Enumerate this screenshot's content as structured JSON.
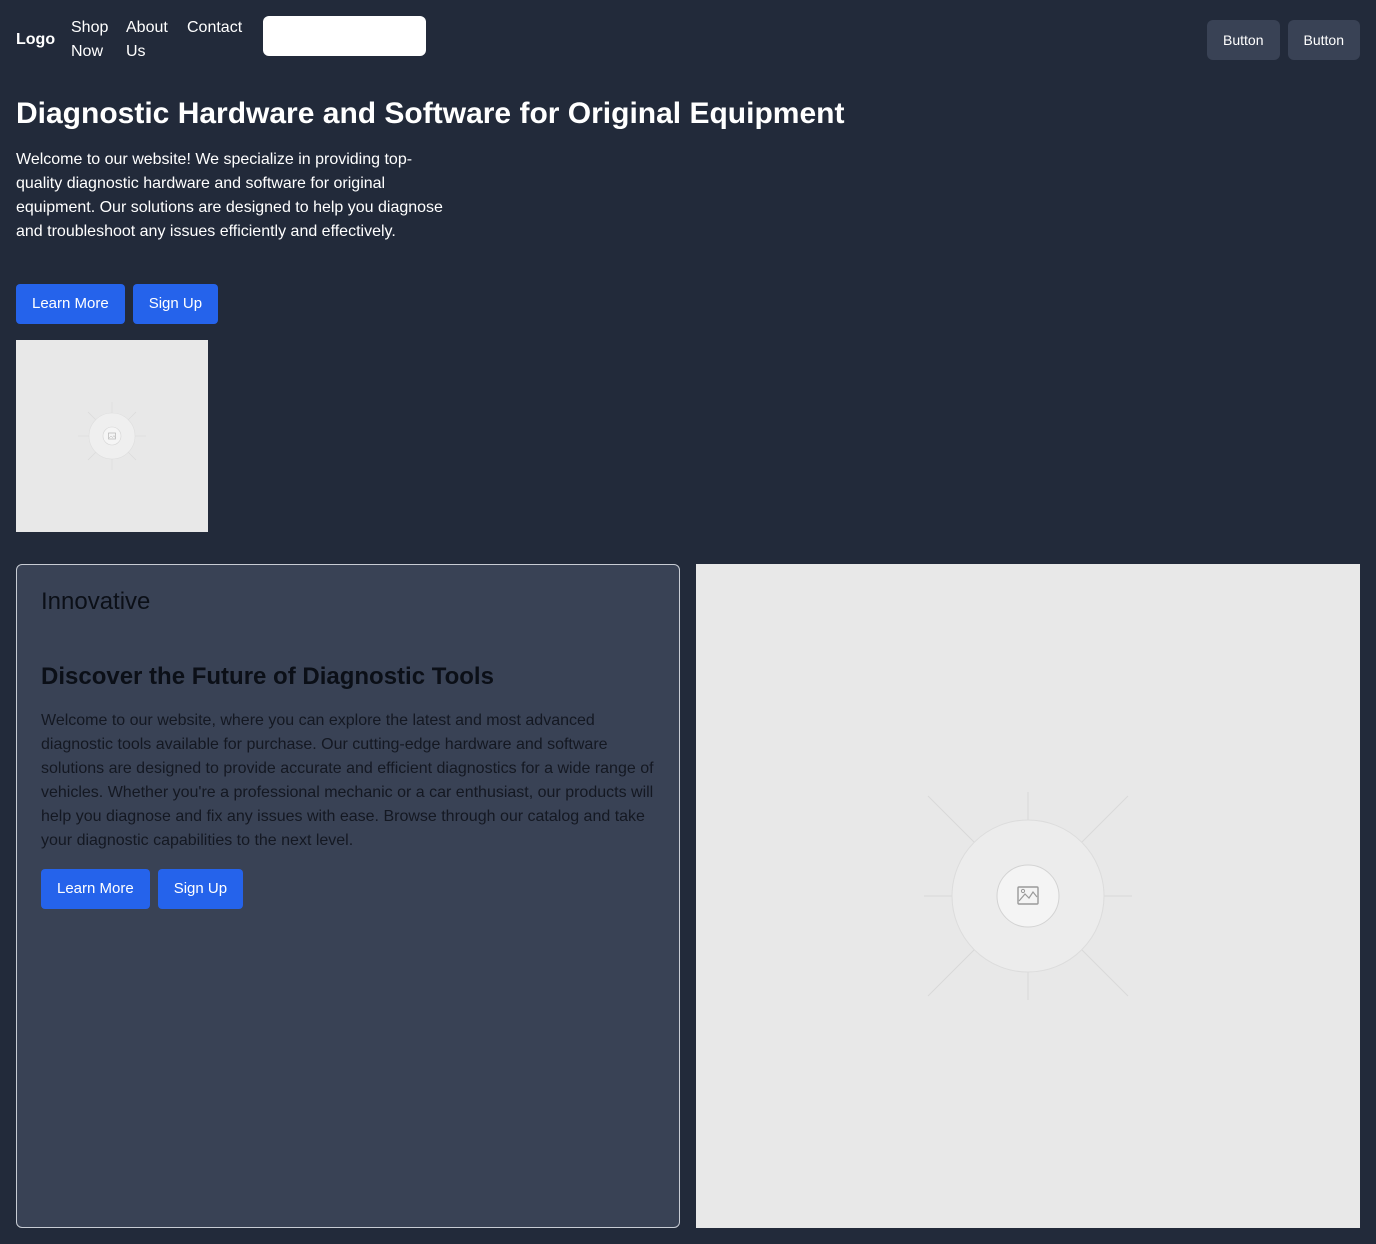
{
  "header": {
    "logo": "Logo",
    "nav": [
      {
        "label": "Shop Now"
      },
      {
        "label": "About Us"
      },
      {
        "label": "Contact"
      }
    ],
    "search": {
      "value": "",
      "placeholder": ""
    },
    "buttons": [
      {
        "label": "Button"
      },
      {
        "label": "Button"
      }
    ]
  },
  "hero": {
    "title": "Diagnostic Hardware and Software for Original Equipment",
    "description": "Welcome to our website! We specialize in providing top-quality diagnostic hardware and software for original equipment. Our solutions are designed to help you diagnose and troubleshoot any issues efficiently and effectively.",
    "primary_label": "Learn More",
    "secondary_label": "Sign Up",
    "image_icon": "image-placeholder-icon"
  },
  "feature": {
    "eyebrow": "Innovative",
    "title": "Discover the Future of Diagnostic Tools",
    "description": "Welcome to our website, where you can explore the latest and most advanced diagnostic tools available for purchase. Our cutting-edge hardware and software solutions are designed to provide accurate and efficient diagnostics for a wide range of vehicles. Whether you're a professional mechanic or a car enthusiast, our products will help you diagnose and fix any issues with ease. Browse through our catalog and take your diagnostic capabilities to the next level.",
    "primary_label": "Learn More",
    "secondary_label": "Sign Up",
    "image_icon": "image-placeholder-icon"
  },
  "colors": {
    "background": "#222a3a",
    "card_background": "#394255",
    "accent": "#2563eb",
    "placeholder": "#e8e8e8"
  }
}
